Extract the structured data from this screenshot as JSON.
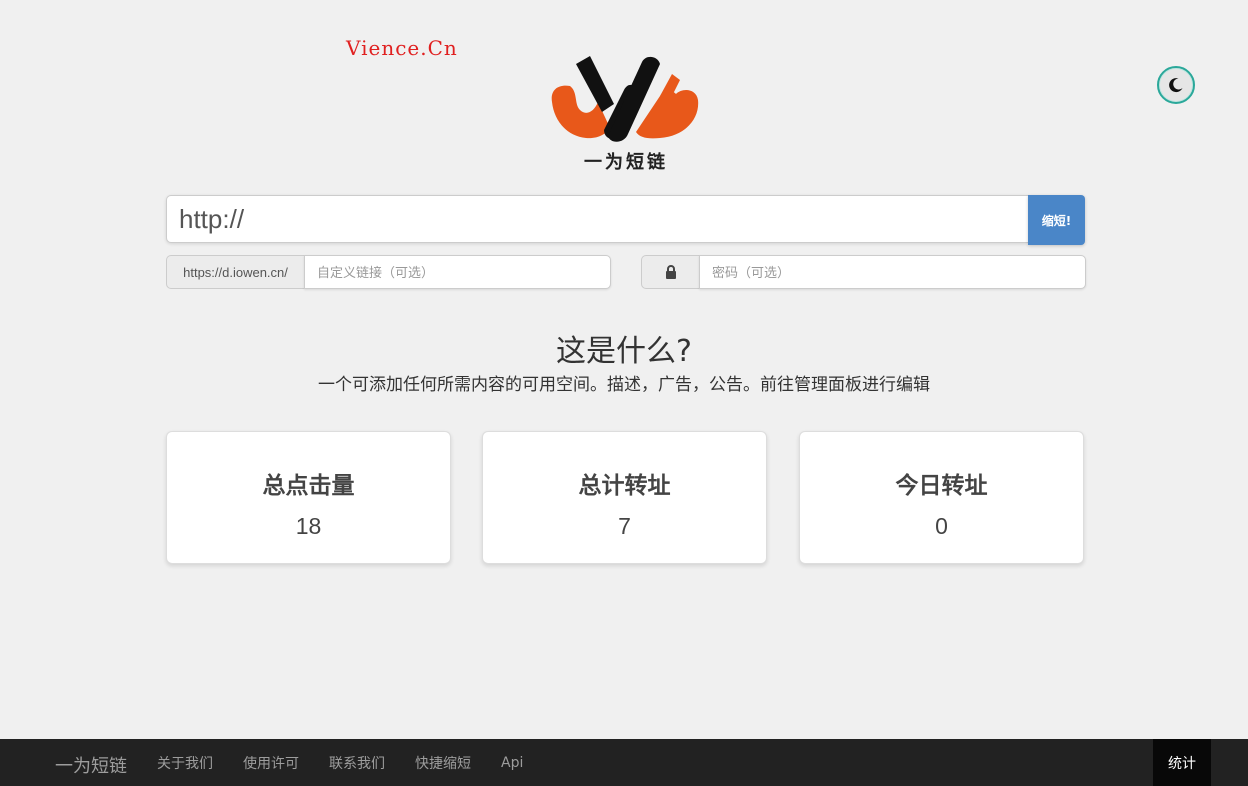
{
  "watermark": "Vience.Cn",
  "brand": {
    "logo_text": "一为短链",
    "colors": {
      "orange": "#e8581a",
      "black": "#111111"
    }
  },
  "theme_toggle": {
    "icon": "moon-icon",
    "accent": "#2aa89a"
  },
  "shortener": {
    "url_value": "http://",
    "button_label": "缩短!",
    "domain_prefix": "https://d.iowen.cn/",
    "custom_placeholder": "自定义链接（可选）",
    "password_placeholder": "密码（可选）",
    "lock_icon": "lock-icon",
    "button_color": "#4a86c8"
  },
  "about": {
    "title": "这是什么?",
    "description": "一个可添加任何所需内容的可用空间。描述，广告，公告。前往管理面板进行编辑"
  },
  "stats": [
    {
      "label": "总点击量",
      "value": "18"
    },
    {
      "label": "总计转址",
      "value": "7"
    },
    {
      "label": "今日转址",
      "value": "0"
    }
  ],
  "footer": {
    "brand": "一为短链",
    "links": [
      "关于我们",
      "使用许可",
      "联系我们",
      "快捷缩短",
      "Api"
    ],
    "stats_label": "统计"
  }
}
